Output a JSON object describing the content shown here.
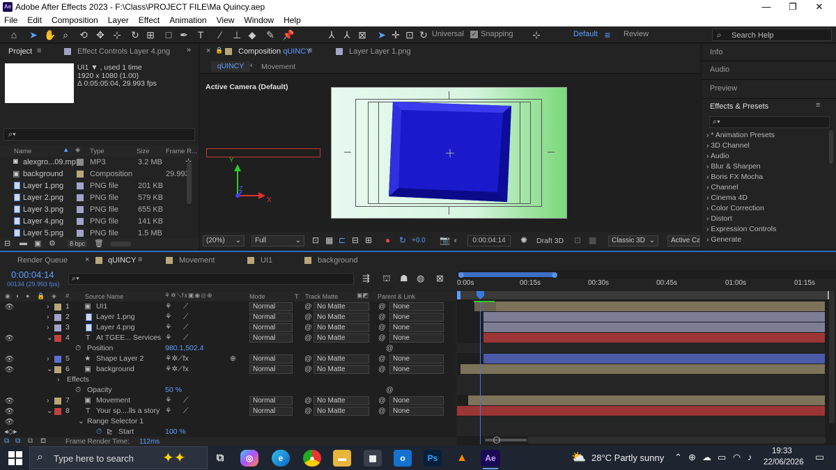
{
  "window": {
    "title": "Adobe After Effects 2023 - F:\\Class\\PROJECT FILE\\Ma Quincy.aep",
    "logo": "Ae"
  },
  "menu": [
    "File",
    "Edit",
    "Composition",
    "Layer",
    "Effect",
    "Animation",
    "View",
    "Window",
    "Help"
  ],
  "toolbar": {
    "universal": "Universal",
    "snapping": "Snapping",
    "workspace_default": "Default",
    "workspace_review": "Review",
    "search_placeholder": "Search Help"
  },
  "project": {
    "tab": "Project",
    "effect_controls": "Effect Controls Layer 4.png",
    "info_name": "UI1 ▼ , used 1 time",
    "info_res": "1920 x 1080 (1.00)",
    "info_dur": "Δ 0:05:05:04, 29.993 fps",
    "search_glyph": "⌕▾",
    "cols": [
      "Name",
      "Type",
      "Size",
      "Frame R..."
    ],
    "items": [
      {
        "name": "alexgro...09.mp3",
        "type": "MP3",
        "size": "3.2 MB",
        "fr": "",
        "color": "#8a8a8a"
      },
      {
        "name": "background",
        "type": "Composition",
        "size": "",
        "fr": "29.993",
        "color": "#b9a77a"
      },
      {
        "name": "Layer 1.png",
        "type": "PNG file",
        "size": "201 KB",
        "fr": "",
        "color": "#a3a3c9"
      },
      {
        "name": "Layer 2.png",
        "type": "PNG file",
        "size": "579 KB",
        "fr": "",
        "color": "#a3a3c9"
      },
      {
        "name": "Layer 3.png",
        "type": "PNG file",
        "size": "655 KB",
        "fr": "",
        "color": "#a3a3c9"
      },
      {
        "name": "Layer 4.png",
        "type": "PNG file",
        "size": "141 KB",
        "fr": "",
        "color": "#a3a3c9"
      },
      {
        "name": "Layer 5.png",
        "type": "PNG file",
        "size": "1.5 MB",
        "fr": "",
        "color": "#a3a3c9"
      }
    ],
    "bpc": "8 bpc"
  },
  "comp": {
    "tab_prefix": "Composition",
    "tab_name": "qUINCY",
    "layer_tab": "Layer Layer 1.png",
    "crumbs": [
      "qUINCY",
      "Movement"
    ],
    "camera": "Active Camera (Default)",
    "zoom": "(20%)",
    "res": "Full",
    "exposure": "+0.0",
    "time": "0:00:04:14",
    "draft": "Draft 3D",
    "renderer": "Classic 3D",
    "view": "Active Ca",
    "axis_x": "X",
    "axis_y": "Y",
    "axis_z": "Z"
  },
  "right": {
    "info": "Info",
    "audio": "Audio",
    "preview": "Preview",
    "effects": "Effects & Presets",
    "search_glyph": "⌕▾",
    "list": [
      "› * Animation Presets",
      "› 3D Channel",
      "› Audio",
      "› Blur & Sharpen",
      "› Boris FX Mocha",
      "› Channel",
      "› Cinema 4D",
      "› Color Correction",
      "› Distort",
      "› Expression Controls",
      "› Generate"
    ]
  },
  "timeline": {
    "tabs": [
      "Render Queue",
      "qUINCY",
      "Movement",
      "UI1",
      "background"
    ],
    "time": "0:00:04:14",
    "frames": "00134 (29.993 fps)",
    "search_glyph": "⌕▾",
    "cols": {
      "source": "Source Name",
      "mode": "Mode",
      "t": "T",
      "matte": "Track Matte",
      "parent": "Parent & Link"
    },
    "ruler": [
      "0:00s",
      "00:15s",
      "00:30s",
      "00:45s",
      "01:00s",
      "01:15s"
    ],
    "layers": [
      {
        "num": "1",
        "name": "UI1",
        "color": "#b9a77a",
        "mode": "Normal",
        "matte": "No Matte",
        "parent": "None",
        "icon": "▣"
      },
      {
        "num": "2",
        "name": "Layer 1.png",
        "color": "#a3a3c9",
        "mode": "Normal",
        "matte": "No Matte",
        "parent": "None",
        "icon": "▫"
      },
      {
        "num": "3",
        "name": "Layer 4.png",
        "color": "#a3a3c9",
        "mode": "Normal",
        "matte": "No Matte",
        "parent": "None",
        "icon": "▫"
      },
      {
        "num": "4",
        "name": "At TGEE... Services",
        "color": "#c24141",
        "mode": "Normal",
        "matte": "No Matte",
        "parent": "None",
        "icon": "T"
      },
      {
        "num": "5",
        "name": "Shape Layer 2",
        "color": "#5f6fd0",
        "mode": "Normal",
        "matte": "No Matte",
        "parent": "None",
        "icon": "★"
      },
      {
        "num": "6",
        "name": "background",
        "color": "#b9a77a",
        "mode": "Normal",
        "matte": "No Matte",
        "parent": "None",
        "icon": "▣"
      },
      {
        "num": "7",
        "name": "Movement",
        "color": "#b9a77a",
        "mode": "Normal",
        "matte": "No Matte",
        "parent": "None",
        "icon": "▣"
      },
      {
        "num": "8",
        "name": "Your sp....lls a story",
        "color": "#c24141",
        "mode": "Normal",
        "matte": "No Matte",
        "parent": "None",
        "icon": "T"
      }
    ],
    "position_label": "Position",
    "position_value": "980.1,502.4",
    "effects_label": "Effects",
    "opacity_label": "Opacity",
    "opacity_value": "50 %",
    "range_label": "Range Selector 1",
    "start_label": "Start",
    "start_value": "100 %",
    "render_time_label": "Frame Render Time:",
    "render_time_value": "112ms"
  },
  "taskbar": {
    "search": "Type here to search",
    "weather": "28°C  Partly sunny",
    "clock_time": "19:33",
    "clock_date": "22/06/2026",
    "ps": "Ps",
    "ae": "Ae"
  }
}
